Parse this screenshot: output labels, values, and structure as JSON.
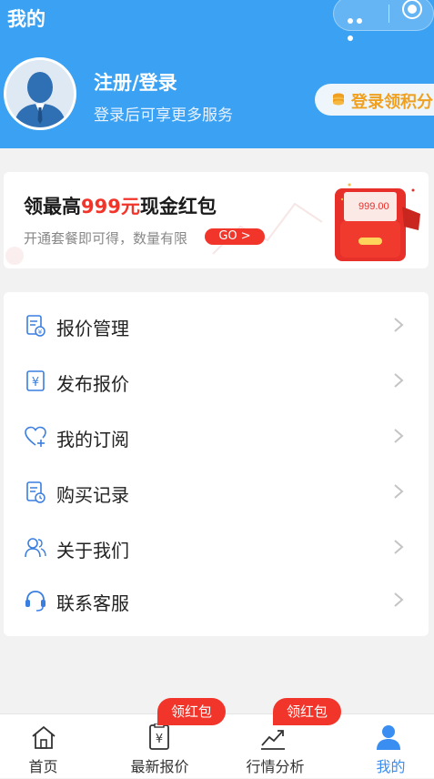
{
  "nav": {
    "title": "我的"
  },
  "profile": {
    "login_title": "注册/登录",
    "login_subtitle": "登录后可享更多服务",
    "points_button": "登录领积分"
  },
  "banner": {
    "title_prefix": "领最高",
    "title_amount": "999元",
    "title_suffix": "现金红包",
    "subtitle": "开通套餐即可得，数量有限",
    "go_button": "GO >",
    "envelope_amount": "999.00"
  },
  "menu": {
    "items": [
      {
        "label": "报价管理",
        "icon": "quote-management-icon"
      },
      {
        "label": "发布报价",
        "icon": "publish-quote-icon"
      },
      {
        "label": "我的订阅",
        "icon": "subscription-heart-icon"
      },
      {
        "label": "购买记录",
        "icon": "purchase-record-icon"
      },
      {
        "label": "关于我们",
        "icon": "about-us-icon"
      },
      {
        "label": "联系客服",
        "icon": "customer-service-icon"
      }
    ]
  },
  "tabbar": {
    "tabs": [
      {
        "label": "首页",
        "icon": "home-icon"
      },
      {
        "label": "最新报价",
        "icon": "latest-quote-icon",
        "badge": "领红包"
      },
      {
        "label": "行情分析",
        "icon": "market-analysis-icon",
        "badge": "领红包"
      },
      {
        "label": "我的",
        "icon": "profile-icon",
        "active": true
      }
    ]
  },
  "colors": {
    "header_blue": "#3aa1f3",
    "accent_red": "#f2352a",
    "active_tab": "#3a8ef2",
    "points_gold": "#f0a020"
  }
}
